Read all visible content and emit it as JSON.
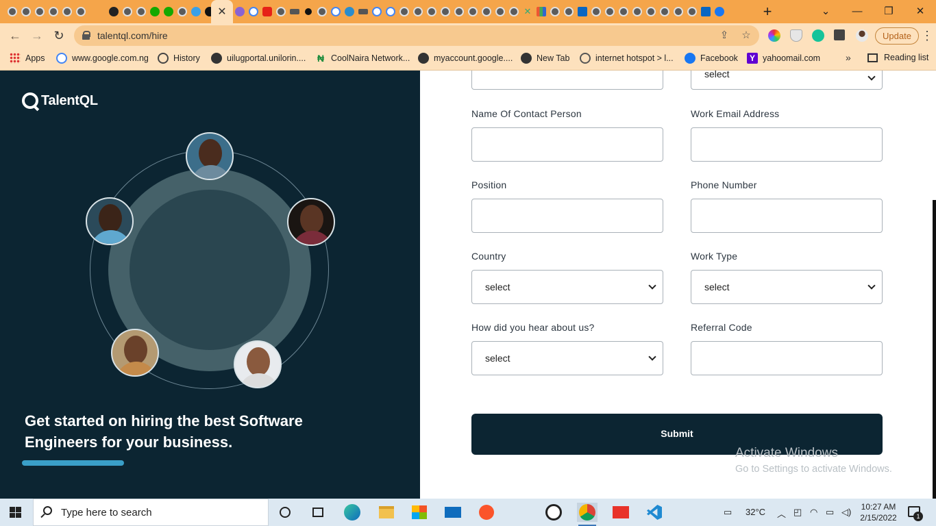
{
  "browser": {
    "active_tab_close": "✕",
    "new_tab": "+",
    "url": "talentql.com/hire",
    "update_label": "Update",
    "window_controls": {
      "list": "⌄",
      "minimize": "—",
      "restore": "❐",
      "close": "✕"
    },
    "bookmarks": [
      {
        "label": "Apps",
        "icon": "apps-grid-icon"
      },
      {
        "label": "www.google.com.ng",
        "icon": "google-icon"
      },
      {
        "label": "History",
        "icon": "history-icon"
      },
      {
        "label": "uilugportal.unilorin....",
        "icon": "globe-icon"
      },
      {
        "label": "CoolNaira Network...",
        "icon": "naira-icon"
      },
      {
        "label": "myaccount.google....",
        "icon": "globe-icon"
      },
      {
        "label": "New Tab",
        "icon": "globe-icon"
      },
      {
        "label": "internet hotspot > l...",
        "icon": "network-icon"
      },
      {
        "label": "Facebook",
        "icon": "facebook-icon"
      },
      {
        "label": "yahoomail.com",
        "icon": "yahoo-icon"
      }
    ],
    "more_bookmarks": "»",
    "reading_list": "Reading list"
  },
  "hero": {
    "brand": "TalentQL",
    "headline": "Get started on hiring the best Software Engineers for your business."
  },
  "form": {
    "top_right_select": "select",
    "fields": {
      "contact_name_label": "Name Of Contact Person",
      "work_email_label": "Work Email Address",
      "position_label": "Position",
      "phone_label": "Phone Number",
      "country_label": "Country",
      "country_value": "select",
      "work_type_label": "Work Type",
      "work_type_value": "select",
      "heard_label": "How did you hear about us?",
      "heard_value": "select",
      "referral_label": "Referral Code"
    },
    "submit_label": "Submit",
    "watermark_line1": "Activate Windows",
    "watermark_line2": "Go to Settings to activate Windows."
  },
  "taskbar": {
    "search_placeholder": "Type here to search",
    "temperature": "32°C",
    "time": "10:27 AM",
    "date": "2/15/2022",
    "notification_count": "1"
  },
  "colors": {
    "tab_strip": "#f5a54a",
    "toolbar": "#fde1bd",
    "hero_bg": "#0c2532",
    "accent_bar": "#3a9fc8",
    "submit_bg": "#0c2532"
  }
}
